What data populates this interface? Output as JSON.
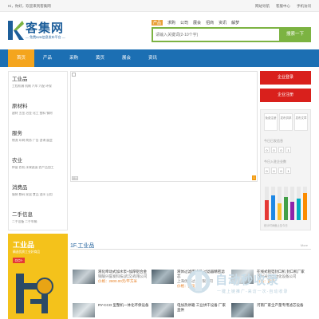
{
  "topbar": {
    "welcome": "Hi，你好，欢迎来到客集网",
    "links": [
      "网站导航",
      "客服中心",
      "手机访问"
    ]
  },
  "logo": {
    "name": "客集网",
    "slogan": "— 免费B2B信息发布平台 —"
  },
  "search": {
    "tabs": [
      "产品",
      "求购",
      "公司",
      "展会",
      "招商",
      "资讯",
      "解梦"
    ],
    "placeholder": "请输入关键词(2-10个字)",
    "button": "搜索一下"
  },
  "nav": {
    "items": [
      "首页",
      "产品",
      "采购",
      "黄页",
      "展会",
      "资讯"
    ]
  },
  "categories": [
    {
      "title": "工业品",
      "sub": "工程机械  机械  汽车  汽配  环保"
    },
    {
      "title": "原材料",
      "sub": "建材  五金  冶金  化工  塑料  钢材"
    },
    {
      "title": "服务",
      "sub": "物流  印刷  商务  广告  咨询  展会"
    },
    {
      "title": "农业",
      "sub": "种苗  农机  水果蔬菜  农产品加工"
    },
    {
      "title": "消费品",
      "sub": "服装  数码  家居  食品  酒水  日用"
    },
    {
      "title": "二手信息",
      "sub": "二手设备  二手车辆"
    }
  ],
  "banner": {
    "ad_label": "广告",
    "page": "1"
  },
  "right": {
    "btn_login": "企业登录",
    "btn_register": "企业注册"
  },
  "stats": {
    "boxes": [
      "免费注册",
      "发布供求",
      "发布文章"
    ],
    "today_label": "今日已发信息",
    "today_digits": [
      "0",
      "0",
      "0",
      "1"
    ],
    "company_label": "今日入驻企业数",
    "company_digits": [
      "0",
      "0",
      "0",
      "1"
    ],
    "note": "统计时间截止至今日"
  },
  "chart_data": {
    "type": "bar",
    "series": [
      {
        "color": "#e53935",
        "values": [
          0.6
        ]
      },
      {
        "color": "#1e88e5",
        "values": [
          0.75
        ]
      },
      {
        "color": "#fbc02d",
        "values": [
          0.5
        ]
      },
      {
        "color": "#43a047",
        "values": [
          0.7
        ]
      },
      {
        "color": "#8e24aa",
        "values": [
          0.55
        ]
      },
      {
        "color": "#00acc1",
        "values": [
          0.65
        ]
      },
      {
        "color": "#fb8c00",
        "values": [
          0.8
        ]
      }
    ]
  },
  "ad_section": {
    "title": "工业品",
    "sub": "精选优质工业好商品",
    "go": "GO>"
  },
  "section": {
    "title": "1F.工业品",
    "more": "More"
  },
  "products": [
    {
      "name": "液化牵动式加水泵+加厚铝合金",
      "company": "铜陵兴誉发科技(武汉)有限公司",
      "price": "价格：2800.00元/平方米"
    },
    {
      "name": "液体过滤用滤芯 过滤器精密滤芯",
      "company": "上海优尔过滤有限公司",
      "price": "价格：面议"
    },
    {
      "name": "在线式铝箔封口机 封口机厂家",
      "company": "苏州米特自动化设备公司",
      "price": "价格：面议"
    },
    {
      "name": "RY-CCO 型整机一体化环保设备",
      "company": "",
      "price": ""
    },
    {
      "name": "电加热烘箱 工业烘干设备 厂家直供",
      "company": "",
      "price": ""
    },
    {
      "name": "河南厂家全产量专用滤芯设备",
      "company": "",
      "price": ""
    }
  ],
  "watermark": {
    "title": "自动秒收录",
    "sub": "一键上链推广-来访一次-自动收录"
  }
}
